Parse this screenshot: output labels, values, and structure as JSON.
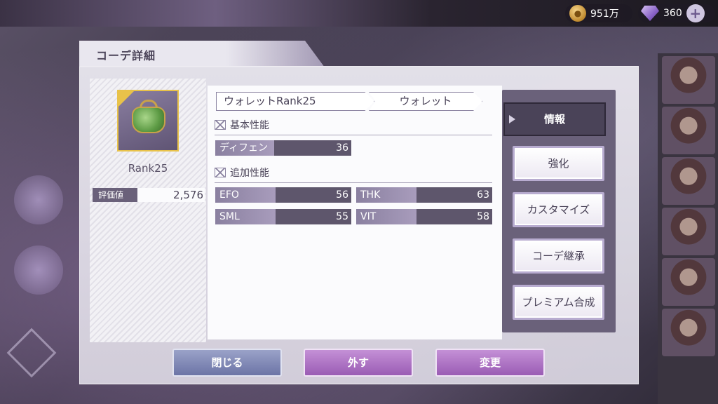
{
  "currency": {
    "coins": "951万",
    "gems": "360",
    "coin_icon": "coin-icon",
    "gem_icon": "gem-icon"
  },
  "dialog": {
    "title": "コーデ詳細"
  },
  "item": {
    "icon": "wallet-icon",
    "rank": "Rank25",
    "score_label": "評価値",
    "score_value": "2,576",
    "name": "ウォレットRank25",
    "category": "ウォレット"
  },
  "basic_section": {
    "heading": "基本性能",
    "stats": [
      {
        "label": "ディフェンス",
        "value": "36"
      }
    ]
  },
  "extra_section": {
    "heading": "追加性能",
    "stats": [
      {
        "label": "EFO",
        "value": "56"
      },
      {
        "label": "THK",
        "value": "63"
      },
      {
        "label": "SML",
        "value": "55"
      },
      {
        "label": "VIT",
        "value": "58"
      }
    ]
  },
  "menu": {
    "items": [
      {
        "label": "情報",
        "selected": true
      },
      {
        "label": "強化"
      },
      {
        "label": "カスタマイズ"
      },
      {
        "label": "コーデ継承"
      },
      {
        "label": "プレミアム合成"
      }
    ]
  },
  "buttons": {
    "close": "閉じる",
    "remove": "外す",
    "change": "変更"
  },
  "colors": {
    "accent_purple": "#9a5cb4",
    "panel_dark": "#6a617a",
    "rank_gold": "#e8c24a"
  }
}
